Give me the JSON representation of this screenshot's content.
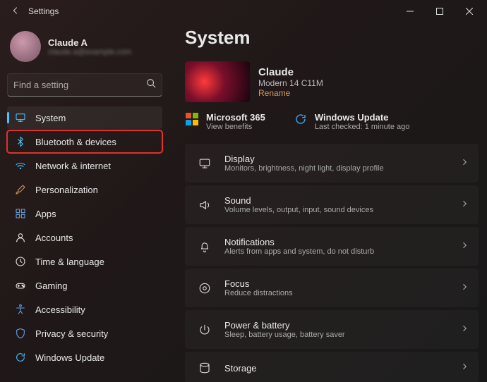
{
  "titlebar": {
    "title": "Settings"
  },
  "user": {
    "name": "Claude A",
    "email": "claude.a@example.com"
  },
  "search": {
    "placeholder": "Find a setting"
  },
  "nav": [
    {
      "label": "System",
      "icon": "system",
      "active": true
    },
    {
      "label": "Bluetooth & devices",
      "icon": "bluetooth",
      "highlight": true
    },
    {
      "label": "Network & internet",
      "icon": "wifi"
    },
    {
      "label": "Personalization",
      "icon": "brush"
    },
    {
      "label": "Apps",
      "icon": "apps"
    },
    {
      "label": "Accounts",
      "icon": "person"
    },
    {
      "label": "Time & language",
      "icon": "clock"
    },
    {
      "label": "Gaming",
      "icon": "gaming"
    },
    {
      "label": "Accessibility",
      "icon": "accessibility"
    },
    {
      "label": "Privacy & security",
      "icon": "shield"
    },
    {
      "label": "Windows Update",
      "icon": "update"
    }
  ],
  "main": {
    "heading": "System",
    "device": {
      "name": "Claude",
      "model": "Modern 14 C11M",
      "rename": "Rename"
    },
    "status": {
      "ms365": {
        "title": "Microsoft 365",
        "sub": "View benefits"
      },
      "wu": {
        "title": "Windows Update",
        "sub": "Last checked: 1 minute ago"
      }
    },
    "tiles": [
      {
        "icon": "display",
        "title": "Display",
        "sub": "Monitors, brightness, night light, display profile"
      },
      {
        "icon": "sound",
        "title": "Sound",
        "sub": "Volume levels, output, input, sound devices"
      },
      {
        "icon": "notifications",
        "title": "Notifications",
        "sub": "Alerts from apps and system, do not disturb"
      },
      {
        "icon": "focus",
        "title": "Focus",
        "sub": "Reduce distractions"
      },
      {
        "icon": "power",
        "title": "Power & battery",
        "sub": "Sleep, battery usage, battery saver"
      },
      {
        "icon": "storage",
        "title": "Storage",
        "sub": ""
      }
    ]
  }
}
